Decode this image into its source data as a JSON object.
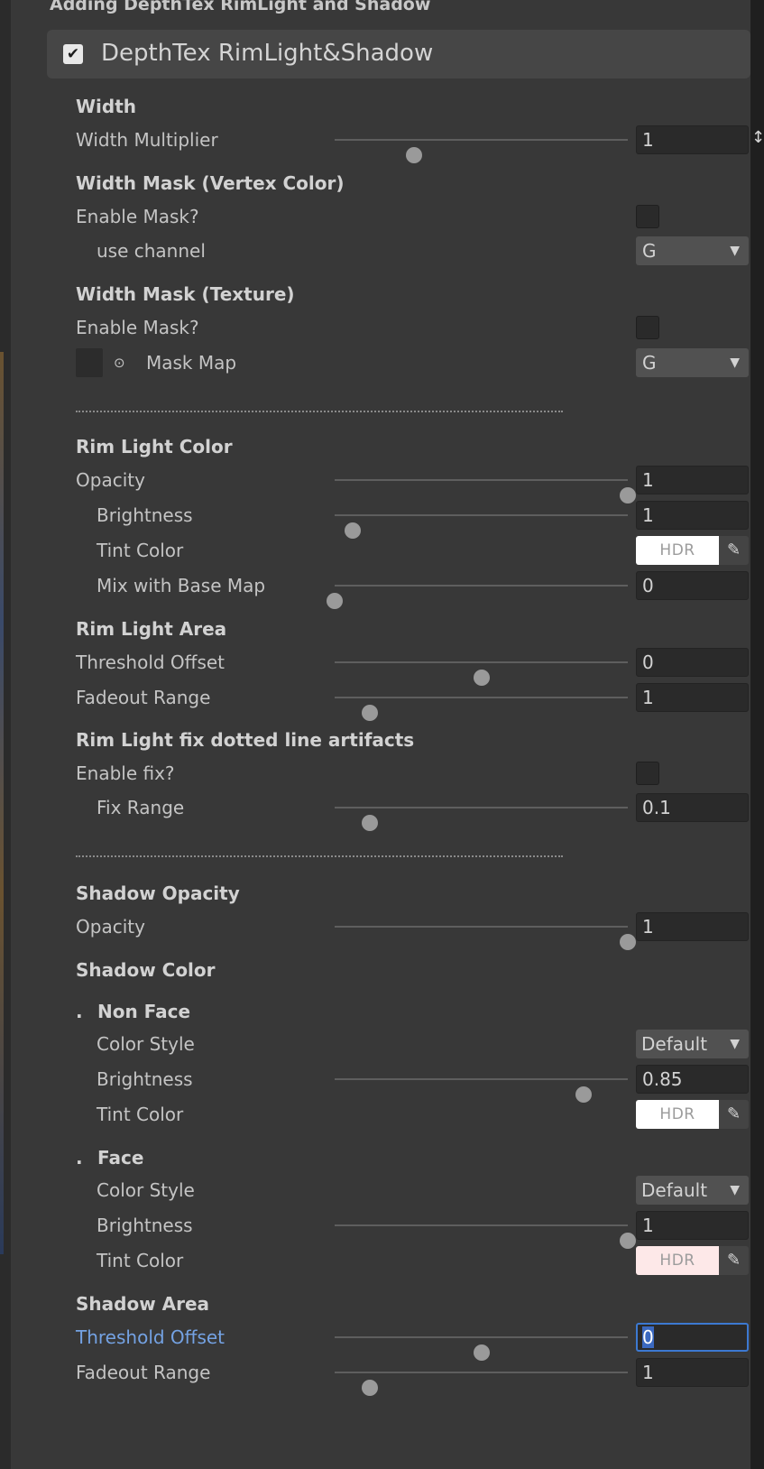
{
  "top_caption": "Adding DepthTex RimLight and Shadow",
  "header": {
    "checked": true,
    "title": "DepthTex RimLight&Shadow"
  },
  "width": {
    "section": "Width",
    "multiplier": {
      "label": "Width Multiplier",
      "value": "1",
      "slider_fraction": 0.27
    }
  },
  "vertex_mask": {
    "section": "Width Mask (Vertex Color)",
    "enable": {
      "label": "Enable Mask?",
      "checked": false
    },
    "channel": {
      "label": "use channel",
      "value": "G"
    }
  },
  "texture_mask": {
    "section": "Width Mask (Texture)",
    "enable": {
      "label": "Enable Mask?",
      "checked": false
    },
    "map": {
      "label": "Mask Map",
      "value": "G"
    }
  },
  "rim_color": {
    "section": "Rim Light Color",
    "opacity": {
      "label": "Opacity",
      "value": "1",
      "slider_fraction": 1.0
    },
    "brightness": {
      "label": "Brightness",
      "value": "1",
      "slider_fraction": 0.06
    },
    "tint": {
      "label": "Tint Color",
      "badge": "HDR",
      "color": "#ffffff"
    },
    "mix": {
      "label": "Mix with Base Map",
      "value": "0",
      "slider_fraction": 0.0
    }
  },
  "rim_area": {
    "section": "Rim Light Area",
    "threshold": {
      "label": "Threshold Offset",
      "value": "0",
      "slider_fraction": 0.5
    },
    "fadeout": {
      "label": "Fadeout Range",
      "value": "1",
      "slider_fraction": 0.12
    }
  },
  "rim_fix": {
    "section": "Rim Light fix dotted line artifacts",
    "enable": {
      "label": "Enable fix?",
      "checked": false
    },
    "range": {
      "label": "Fix Range",
      "value": "0.1",
      "slider_fraction": 0.12
    }
  },
  "shadow_opacity": {
    "section": "Shadow Opacity",
    "opacity": {
      "label": "Opacity",
      "value": "1",
      "slider_fraction": 1.0
    }
  },
  "shadow_color": {
    "section": "Shadow Color",
    "non_face": {
      "title": "Non Face",
      "style": {
        "label": "Color Style",
        "value": "Default"
      },
      "brightness": {
        "label": "Brightness",
        "value": "0.85",
        "slider_fraction": 0.85
      },
      "tint": {
        "label": "Tint Color",
        "badge": "HDR",
        "color": "#ffffff"
      }
    },
    "face": {
      "title": "Face",
      "style": {
        "label": "Color Style",
        "value": "Default"
      },
      "brightness": {
        "label": "Brightness",
        "value": "1",
        "slider_fraction": 1.0
      },
      "tint": {
        "label": "Tint Color",
        "badge": "HDR",
        "color": "#fde8e8"
      }
    }
  },
  "shadow_area": {
    "section": "Shadow Area",
    "threshold": {
      "label": "Threshold Offset",
      "value": "0",
      "slider_fraction": 0.5
    },
    "fadeout": {
      "label": "Fadeout Range",
      "value": "1",
      "slider_fraction": 0.12
    }
  },
  "colors": {
    "background": "#383838",
    "header_bar": "#464646",
    "field": "#2a2a2a",
    "focus_border": "#3c79d1",
    "focused_label": "#74a2e3"
  },
  "icons": {
    "check": "✔",
    "dropdown_arrow": "▼",
    "object_picker": "⊙",
    "eyedropper": "eyedropper-icon"
  }
}
